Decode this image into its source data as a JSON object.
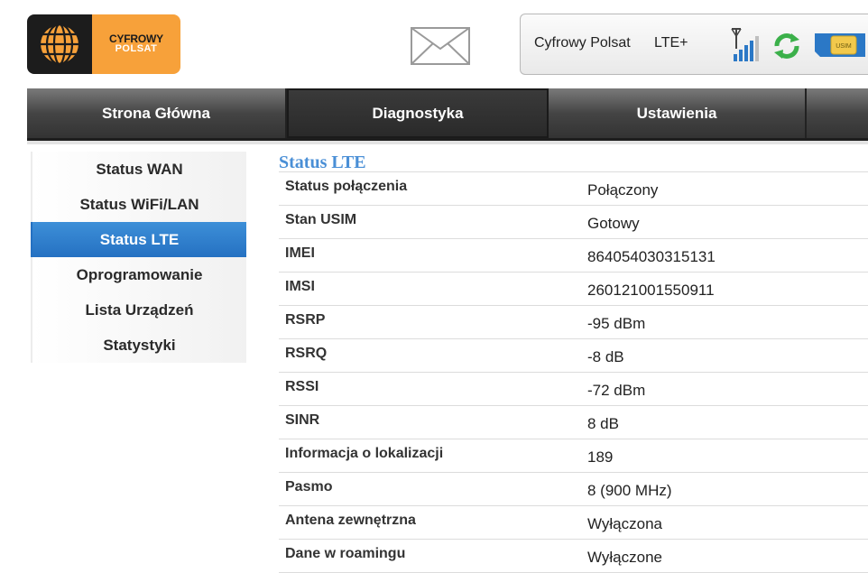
{
  "header": {
    "logo": {
      "line1": "CYFROWY",
      "line2": "POLSAT"
    },
    "operator": "Cyfrowy Polsat",
    "network_type": "LTE+",
    "signal_icon": "signal-antenna-icon",
    "refresh_icon": "refresh-icon",
    "sim_icon": "usim-card-icon",
    "sim_label": "USIM",
    "mail_icon": "envelope-icon"
  },
  "nav": {
    "tabs": [
      {
        "label": "Strona Główna"
      },
      {
        "label": "Diagnostyka"
      },
      {
        "label": "Ustawienia"
      },
      {
        "label": ""
      }
    ],
    "active_index": 1
  },
  "sidebar": {
    "items": [
      {
        "label": "Status WAN"
      },
      {
        "label": "Status WiFi/LAN"
      },
      {
        "label": "Status LTE"
      },
      {
        "label": "Oprogramowanie"
      },
      {
        "label": "Lista Urządzeń"
      },
      {
        "label": "Statystyki"
      }
    ],
    "active_index": 2
  },
  "main": {
    "title": "Status LTE",
    "rows": [
      {
        "label": "Status połączenia",
        "value": "Połączony"
      },
      {
        "label": "Stan USIM",
        "value": "Gotowy"
      },
      {
        "label": "IMEI",
        "value": "864054030315131"
      },
      {
        "label": "IMSI",
        "value": "260121001550911"
      },
      {
        "label": "RSRP",
        "value": "-95 dBm"
      },
      {
        "label": "RSRQ",
        "value": "-8 dB"
      },
      {
        "label": "RSSI",
        "value": "-72 dBm"
      },
      {
        "label": "SINR",
        "value": "8 dB"
      },
      {
        "label": "Informacja o lokalizacji",
        "value": "189"
      },
      {
        "label": "Pasmo",
        "value": "8 (900 MHz)"
      },
      {
        "label": "Antena zewnętrzna",
        "value": "Wyłączona"
      },
      {
        "label": "Dane w roamingu",
        "value": "Wyłączone"
      }
    ]
  },
  "colors": {
    "brand_orange": "#f7a13a",
    "active_blue": "#2f80cf",
    "title_blue": "#4a8fd6",
    "nav_dark": "#3a3a3a"
  }
}
